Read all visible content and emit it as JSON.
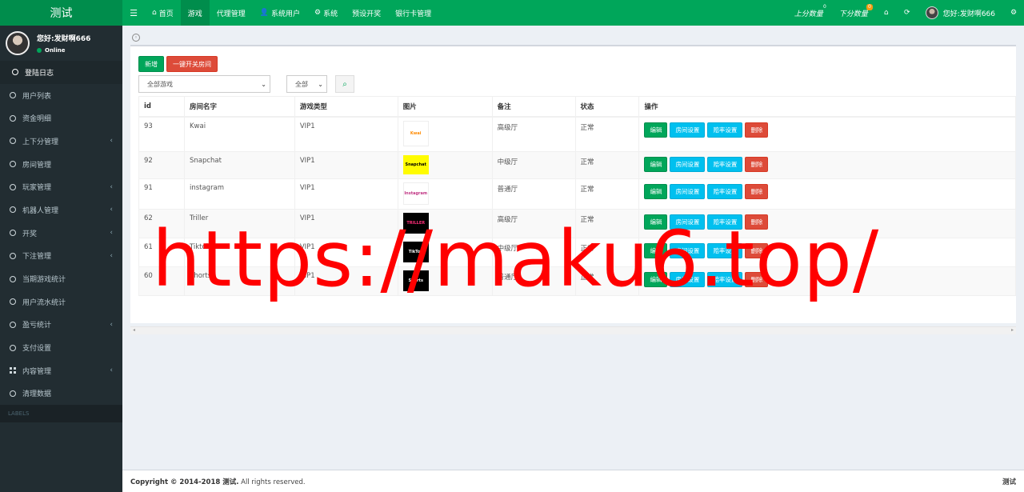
{
  "app": {
    "title": "测试"
  },
  "nav": {
    "toggle_icon": "menu-icon",
    "items": [
      {
        "label": "首页",
        "icon": "home-icon",
        "glyph": "⌂",
        "active": false
      },
      {
        "label": "游戏",
        "icon": "",
        "glyph": "",
        "active": true
      },
      {
        "label": "代理管理",
        "icon": "",
        "glyph": "",
        "active": false
      },
      {
        "label": "系统用户",
        "icon": "user-icon",
        "glyph": "👤",
        "active": false
      },
      {
        "label": "系统",
        "icon": "gear-icon",
        "glyph": "⚙",
        "active": false
      },
      {
        "label": "预设开奖",
        "icon": "",
        "glyph": "",
        "active": false
      },
      {
        "label": "银行卡管理",
        "icon": "",
        "glyph": "",
        "active": false
      }
    ],
    "right": {
      "up_label": "上分数量",
      "up_badge": "0",
      "down_label": "下分数量",
      "down_badge": "0",
      "greeting": "您好:发财啊666"
    }
  },
  "sidebar": {
    "user": {
      "name": "您好:发财啊666",
      "status": "Online"
    },
    "items": [
      {
        "label": "登陆日志",
        "icon": "circle",
        "active": true,
        "has_children": false
      },
      {
        "label": "用户列表",
        "icon": "circle",
        "active": false,
        "has_children": false
      },
      {
        "label": "资金明细",
        "icon": "circle",
        "active": false,
        "has_children": false
      },
      {
        "label": "上下分管理",
        "icon": "circle",
        "active": false,
        "has_children": true
      },
      {
        "label": "房间管理",
        "icon": "circle",
        "active": false,
        "has_children": false
      },
      {
        "label": "玩家管理",
        "icon": "circle",
        "active": false,
        "has_children": true
      },
      {
        "label": "机器人管理",
        "icon": "circle",
        "active": false,
        "has_children": true
      },
      {
        "label": "开奖",
        "icon": "circle",
        "active": false,
        "has_children": true
      },
      {
        "label": "下注管理",
        "icon": "circle",
        "active": false,
        "has_children": true
      },
      {
        "label": "当期游戏统计",
        "icon": "circle",
        "active": false,
        "has_children": false
      },
      {
        "label": "用户流水统计",
        "icon": "circle",
        "active": false,
        "has_children": false
      },
      {
        "label": "盈亏统计",
        "icon": "circle",
        "active": false,
        "has_children": true
      },
      {
        "label": "支付设置",
        "icon": "circle",
        "active": false,
        "has_children": false
      },
      {
        "label": "内容管理",
        "icon": "grid",
        "active": false,
        "has_children": true
      },
      {
        "label": "清理数据",
        "icon": "circle",
        "active": false,
        "has_children": false
      }
    ],
    "section_label": "LABELS"
  },
  "toolbar": {
    "add_label": "新增",
    "toggle_rooms_label": "一键开关房间"
  },
  "filters": {
    "game_select": "全部游戏",
    "type_select": "全部"
  },
  "table": {
    "headers": [
      "id",
      "房间名字",
      "游戏类型",
      "图片",
      "备注",
      "状态",
      "操作"
    ],
    "actions": {
      "edit": "编辑",
      "room_settings": "房间设置",
      "odds_settings": "赔率设置",
      "delete": "删除"
    },
    "rows": [
      {
        "id": "93",
        "name": "Kwai",
        "type": "VIP1",
        "img_text": "Kwai",
        "img_bg": "#ffffff",
        "img_fg": "#ff8a00",
        "note": "高级厅",
        "status": "正常",
        "h": 44
      },
      {
        "id": "92",
        "name": "Snapchat",
        "type": "VIP1",
        "img_text": "Snapchat",
        "img_bg": "#fffc00",
        "img_fg": "#000000",
        "note": "中级厅",
        "status": "正常",
        "h": 34
      },
      {
        "id": "91",
        "name": "instagram",
        "type": "VIP1",
        "img_text": "Instagram",
        "img_bg": "#ffffff",
        "img_fg": "#c13584",
        "note": "普通厅",
        "status": "正常",
        "h": 38
      },
      {
        "id": "62",
        "name": "Triller",
        "type": "VIP1",
        "img_text": "TRILLER",
        "img_bg": "#000000",
        "img_fg": "#ff2d7a",
        "note": "高级厅",
        "status": "正常",
        "h": 36
      },
      {
        "id": "61",
        "name": "Tiktok",
        "type": "VIP1",
        "img_text": "TikTok",
        "img_bg": "#000000",
        "img_fg": "#ffffff",
        "note": "中级厅",
        "status": "正常",
        "h": 36
      },
      {
        "id": "60",
        "name": "Shorts",
        "type": "VIP1",
        "img_text": "Shorts",
        "img_bg": "#000000",
        "img_fg": "#ffffff",
        "note": "普通厅",
        "status": "正常",
        "h": 36
      }
    ]
  },
  "footer": {
    "copyright_prefix": "Copyright © 2014-2018 ",
    "brand": "测试.",
    "suffix": " All rights reserved.",
    "right": "测试"
  },
  "watermark": "https://maku6.top/",
  "colors": {
    "primary": "#00a65a",
    "primary_dark": "#008d4c",
    "danger": "#dd4b39",
    "info": "#00c0ef",
    "sidebar": "#222d32"
  }
}
